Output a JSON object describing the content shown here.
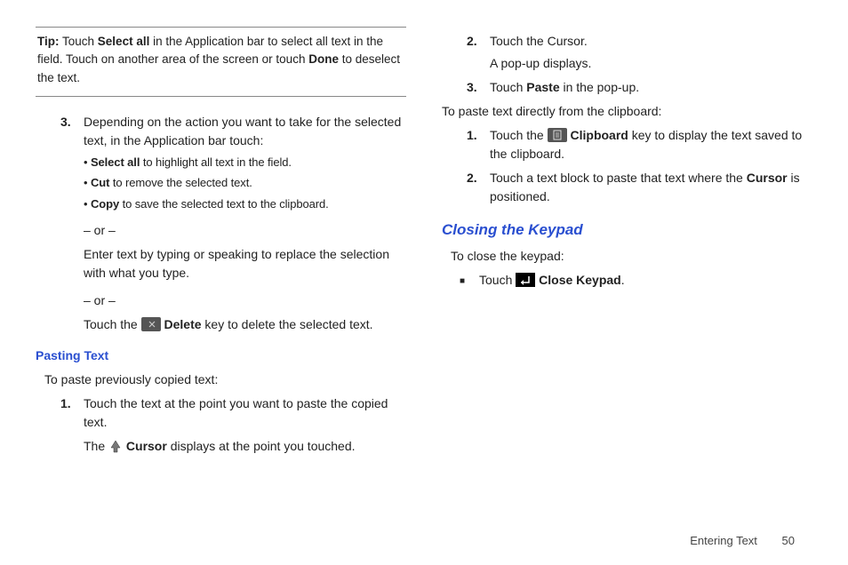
{
  "tip": {
    "lead": "Tip:",
    "t1": " Touch ",
    "b1": "Select all",
    "t2": " in the Application bar to select all text in the field. Touch on another area of the screen or touch ",
    "b2": "Done",
    "t3": " to deselect the text."
  },
  "left": {
    "step3": {
      "num": "3.",
      "text": "Depending on the action you want to take for the selected text, in the Application bar touch:",
      "bullets": [
        {
          "b": "Select all",
          "rest": " to highlight all text in the field."
        },
        {
          "b": "Cut",
          "rest": " to remove the selected text."
        },
        {
          "b": "Copy",
          "rest": " to save the selected text to the clipboard."
        }
      ],
      "or1": "– or –",
      "alt1": "Enter text by typing or speaking to replace the selection with what you type.",
      "or2": "– or –",
      "alt2a": "Touch the ",
      "alt2_b": "Delete",
      "alt2c": " key to delete the selected text."
    },
    "pasting_heading": "Pasting Text",
    "pasting_intro": "To paste previously copied text:",
    "pstep1": {
      "num": "1.",
      "text": "Touch the text at the point you want to paste the copied text.",
      "sub_a": "The ",
      "sub_b": "Cursor",
      "sub_c": " displays at the point you touched."
    }
  },
  "right": {
    "pstep2": {
      "num": "2.",
      "line1": "Touch the Cursor.",
      "line2": "A pop-up displays."
    },
    "pstep3": {
      "num": "3.",
      "a": "Touch ",
      "b": "Paste",
      "c": " in the pop-up."
    },
    "direct_intro": "To paste text directly from the clipboard:",
    "dstep1": {
      "num": "1.",
      "a": "Touch the ",
      "b": "Clipboard",
      "c": " key to display the text saved to the clipboard."
    },
    "dstep2": {
      "num": "2.",
      "a": "Touch a text block to paste that text where the ",
      "b": "Cursor",
      "c": " is positioned."
    },
    "closing_heading": "Closing the Keypad",
    "closing_intro": "To close the keypad:",
    "closing_item": {
      "a": "Touch ",
      "b": "Close Keypad",
      "c": "."
    }
  },
  "footer": {
    "section": "Entering Text",
    "page": "50"
  }
}
